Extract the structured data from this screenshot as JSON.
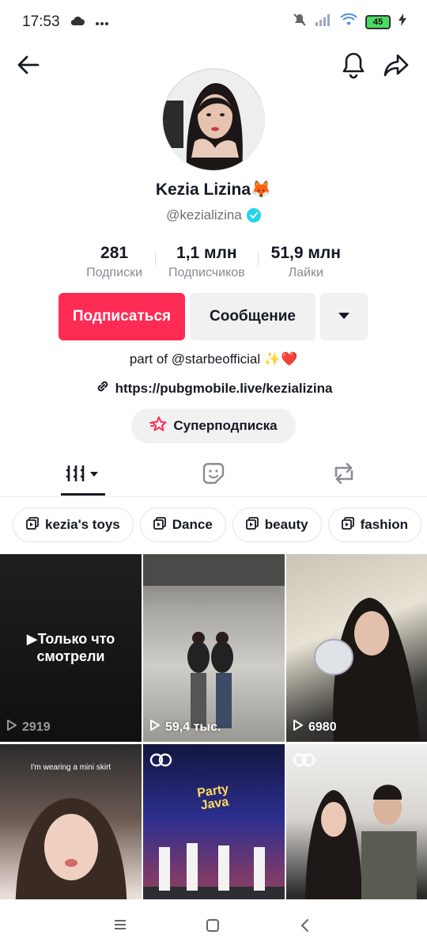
{
  "status": {
    "time": "17:53",
    "battery": "45"
  },
  "profile": {
    "name": "Kezia Lizina",
    "name_emoji": "🦊",
    "handle": "@kezializina",
    "bio": "part of @starbeofficial ✨❤️",
    "link": "https://pubgmobile.live/kezializina"
  },
  "stats": {
    "following_count": "281",
    "following_label": "Подписки",
    "followers_count": "1,1 млн",
    "followers_label": "Подписчиков",
    "likes_count": "51,9 млн",
    "likes_label": "Лайки"
  },
  "actions": {
    "follow_label": "Подписаться",
    "message_label": "Сообщение"
  },
  "superfollow": {
    "label": "Суперподписка"
  },
  "playlists": [
    {
      "label": "kezia's toys"
    },
    {
      "label": "Dance"
    },
    {
      "label": "beauty"
    },
    {
      "label": "fashion"
    }
  ],
  "videos": [
    {
      "views": "2919",
      "overlay_text": "Только что смотрели"
    },
    {
      "views": "59,4 тыс."
    },
    {
      "views": "6980"
    },
    {
      "caption": "I'm wearing a mini skirt"
    },
    {
      "sign": "Party Java"
    },
    {}
  ],
  "colors": {
    "accent": "#fe2c55",
    "verified": "#20d5ec"
  }
}
